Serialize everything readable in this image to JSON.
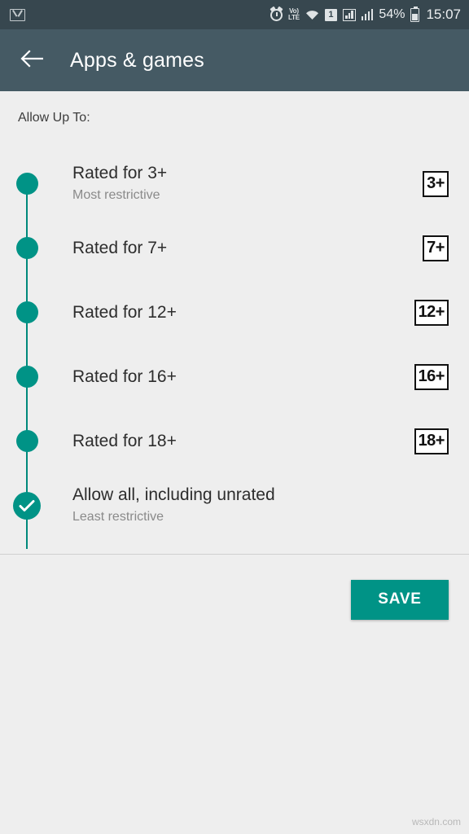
{
  "status_bar": {
    "notification_icon": "gmail-icon",
    "icons": [
      "alarm-clock-icon",
      "volte-icon",
      "wifi-icon",
      "sim1-icon",
      "signal-boxed-icon",
      "signal-bars-icon"
    ],
    "volte_top": "Vo)",
    "volte_bottom": "LTE",
    "sim_label": "1",
    "battery_percent": "54%",
    "time": "15:07"
  },
  "app_bar": {
    "back_icon": "back-arrow-icon",
    "title": "Apps & games"
  },
  "content": {
    "section_label": "Allow Up To:",
    "items": [
      {
        "title": "Rated for 3+",
        "subtitle": "Most restrictive",
        "badge": "3+",
        "selected": false
      },
      {
        "title": "Rated for 7+",
        "subtitle": "",
        "badge": "7+",
        "selected": false
      },
      {
        "title": "Rated for 12+",
        "subtitle": "",
        "badge": "12+",
        "selected": false
      },
      {
        "title": "Rated for 16+",
        "subtitle": "",
        "badge": "16+",
        "selected": false
      },
      {
        "title": "Rated for 18+",
        "subtitle": "",
        "badge": "18+",
        "selected": false
      },
      {
        "title": "Allow all, including unrated",
        "subtitle": "Least restrictive",
        "badge": "",
        "selected": true
      }
    ]
  },
  "footer": {
    "save_label": "SAVE"
  },
  "watermark": "wsxdn.com",
  "colors": {
    "status_bar": "#37474f",
    "app_bar": "#455a64",
    "accent": "#009386",
    "background": "#eeeeee"
  }
}
